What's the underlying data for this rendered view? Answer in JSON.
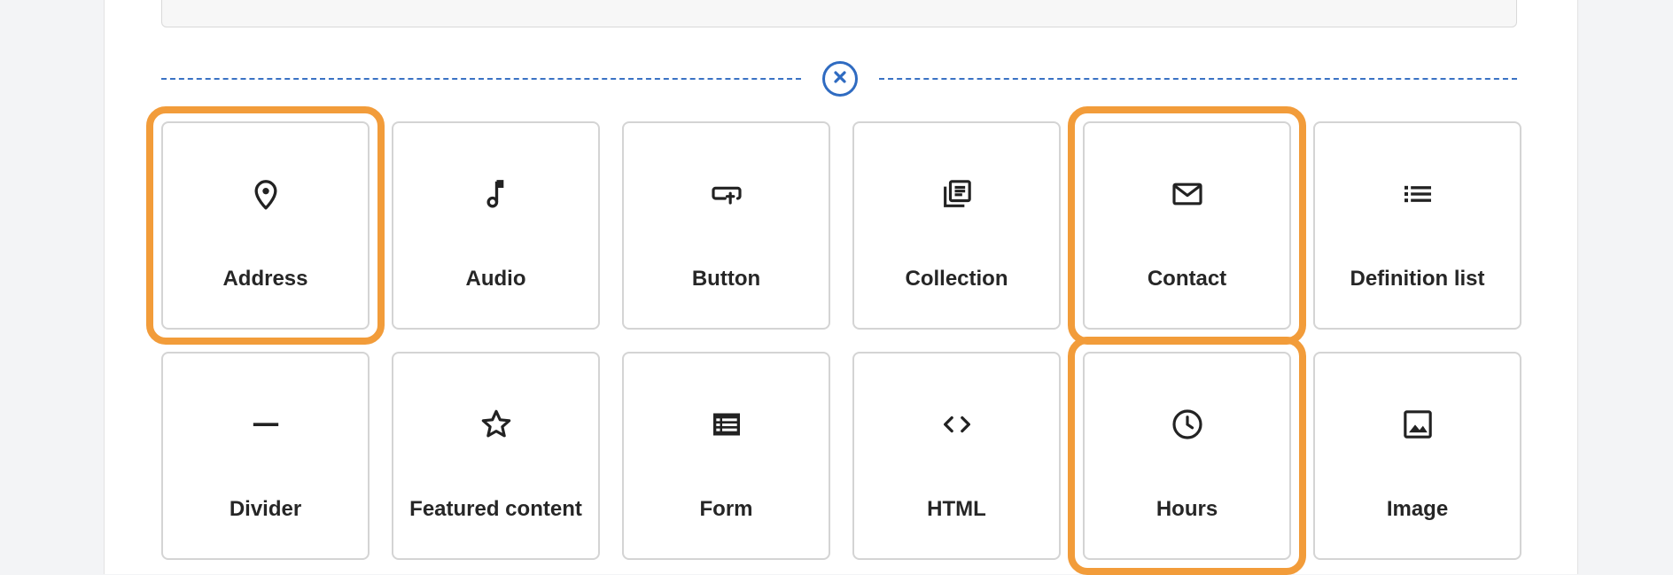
{
  "close_icon": "circle-x-icon",
  "accent_color": "#2f6bc1",
  "highlight_color": "#f29c3a",
  "cards": [
    {
      "label": "Address",
      "icon": "map-pin-icon",
      "highlighted": true
    },
    {
      "label": "Audio",
      "icon": "music-note-icon",
      "highlighted": false
    },
    {
      "label": "Button",
      "icon": "button-cursor-icon",
      "highlighted": false
    },
    {
      "label": "Collection",
      "icon": "collection-icon",
      "highlighted": false
    },
    {
      "label": "Contact",
      "icon": "envelope-icon",
      "highlighted": true
    },
    {
      "label": "Definition list",
      "icon": "list-icon",
      "highlighted": false
    },
    {
      "label": "Divider",
      "icon": "horizontal-rule-icon",
      "highlighted": false
    },
    {
      "label": "Featured content",
      "icon": "star-icon",
      "highlighted": false
    },
    {
      "label": "Form",
      "icon": "form-table-icon",
      "highlighted": false
    },
    {
      "label": "HTML",
      "icon": "code-icon",
      "highlighted": false
    },
    {
      "label": "Hours",
      "icon": "clock-icon",
      "highlighted": true
    },
    {
      "label": "Image",
      "icon": "image-icon",
      "highlighted": false
    }
  ]
}
